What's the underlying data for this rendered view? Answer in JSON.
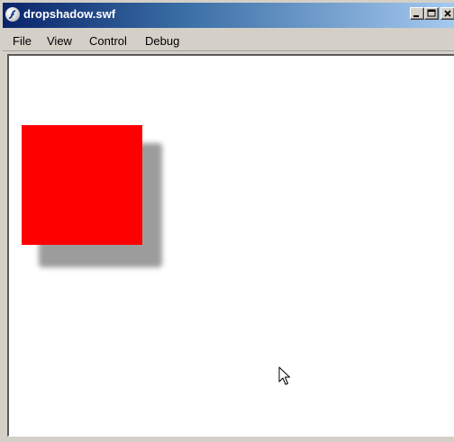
{
  "window": {
    "title": "dropshadow.swf",
    "icon": "flash-player-icon",
    "buttons": {
      "minimize": "minimize-icon",
      "maximize": "maximize-icon",
      "close": "close-icon"
    }
  },
  "menubar": {
    "items": [
      {
        "label": "File"
      },
      {
        "label": "View"
      },
      {
        "label": "Control"
      },
      {
        "label": "Debug"
      }
    ]
  },
  "stage": {
    "background": "#ffffff",
    "square_color": "#ff0000",
    "shadow_color": "#9c9c9c",
    "cursor": "arrow-cursor-icon"
  },
  "colors": {
    "titlebar_start": "#0a246a",
    "titlebar_end": "#a6caf0",
    "chrome": "#d4d0c8"
  }
}
